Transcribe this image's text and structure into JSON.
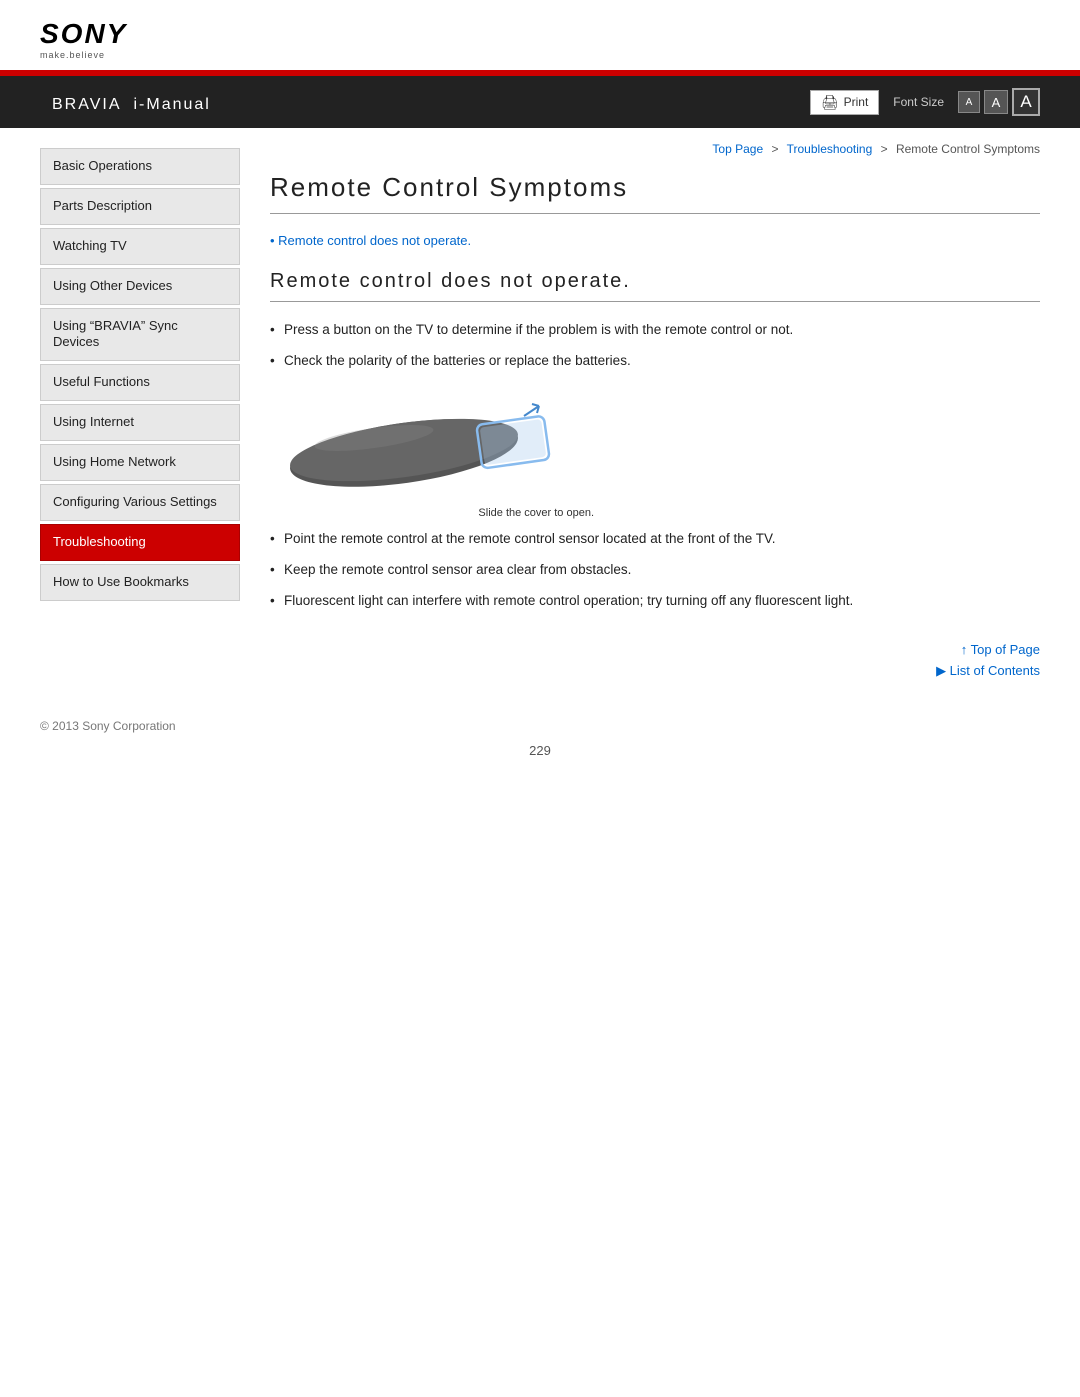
{
  "brand": {
    "name": "SONY",
    "tagline": "make.believe",
    "product": "BRAVIA",
    "manual": "i-Manual"
  },
  "toolbar": {
    "print_label": "Print",
    "font_size_label": "Font Size",
    "font_small": "A",
    "font_medium": "A",
    "font_large": "A"
  },
  "breadcrumb": {
    "top_page": "Top Page",
    "sep1": ">",
    "troubleshooting": "Troubleshooting",
    "sep2": ">",
    "current": "Remote Control Symptoms"
  },
  "sidebar": {
    "items": [
      {
        "id": "basic-operations",
        "label": "Basic Operations",
        "active": false
      },
      {
        "id": "parts-description",
        "label": "Parts Description",
        "active": false
      },
      {
        "id": "watching-tv",
        "label": "Watching TV",
        "active": false
      },
      {
        "id": "using-other-devices",
        "label": "Using Other Devices",
        "active": false
      },
      {
        "id": "using-bravia-sync",
        "label": "Using “BRAVIA” Sync Devices",
        "active": false
      },
      {
        "id": "useful-functions",
        "label": "Useful Functions",
        "active": false
      },
      {
        "id": "using-internet",
        "label": "Using Internet",
        "active": false
      },
      {
        "id": "using-home-network",
        "label": "Using Home Network",
        "active": false
      },
      {
        "id": "configuring-settings",
        "label": "Configuring Various Settings",
        "active": false
      },
      {
        "id": "troubleshooting",
        "label": "Troubleshooting",
        "active": true
      },
      {
        "id": "how-to-use",
        "label": "How to Use Bookmarks",
        "active": false
      }
    ]
  },
  "content": {
    "page_title": "Remote Control Symptoms",
    "toc_link": "Remote control does not operate.",
    "section_heading": "Remote control does not operate.",
    "bullets": [
      "Press a button on the TV to determine if the problem is with the remote control or not.",
      "Check the polarity of the batteries or replace the batteries.",
      "Point the remote control at the remote control sensor located at the front of the TV.",
      "Keep the remote control sensor area clear from obstacles.",
      "Fluorescent light can interfere with remote control operation; try turning off any fluorescent light."
    ],
    "slide_label": "Slide the cover to open.",
    "top_of_page": "Top of Page",
    "list_of_contents": "List of Contents"
  },
  "footer": {
    "copyright": "© 2013 Sony Corporation",
    "page_number": "229"
  }
}
